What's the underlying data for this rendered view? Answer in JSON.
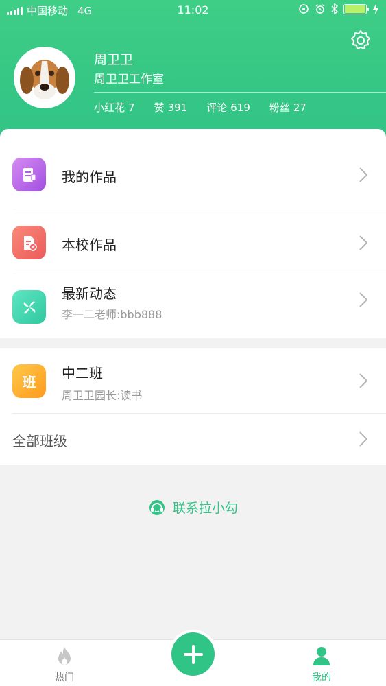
{
  "status_bar": {
    "carrier": "中国移动",
    "network": "4G",
    "time": "11:02"
  },
  "profile": {
    "name": "周卫卫",
    "studio": "周卫卫工作室",
    "stats": [
      {
        "label": "小红花",
        "value": "7"
      },
      {
        "label": "赞",
        "value": "391"
      },
      {
        "label": "评论",
        "value": "619"
      },
      {
        "label": "粉丝",
        "value": "27"
      }
    ]
  },
  "menu": {
    "my_works": {
      "title": "我的作品",
      "icon": "document-icon",
      "color": "#b45ee6"
    },
    "school_works": {
      "title": "本校作品",
      "icon": "document-badge-icon",
      "color": "#f06a6a"
    },
    "latest_news": {
      "title": "最新动态",
      "subtitle": "李一二老师:bbb888",
      "icon": "pinwheel-icon",
      "color": "#3fd4b0"
    }
  },
  "class_section": {
    "class_item": {
      "badge": "班",
      "title": "中二班",
      "subtitle": "周卫卫园长:读书",
      "color": "#ffb02e"
    },
    "all_classes": {
      "title": "全部班级"
    }
  },
  "contact": {
    "label": "联系拉小勾",
    "icon": "customer-service-icon"
  },
  "tabbar": {
    "hot": {
      "label": "热门",
      "icon": "flame-icon"
    },
    "add": {
      "icon": "plus-icon"
    },
    "mine": {
      "label": "我的",
      "icon": "person-icon"
    }
  },
  "colors": {
    "accent": "#31c487",
    "header": "#3fce86"
  }
}
